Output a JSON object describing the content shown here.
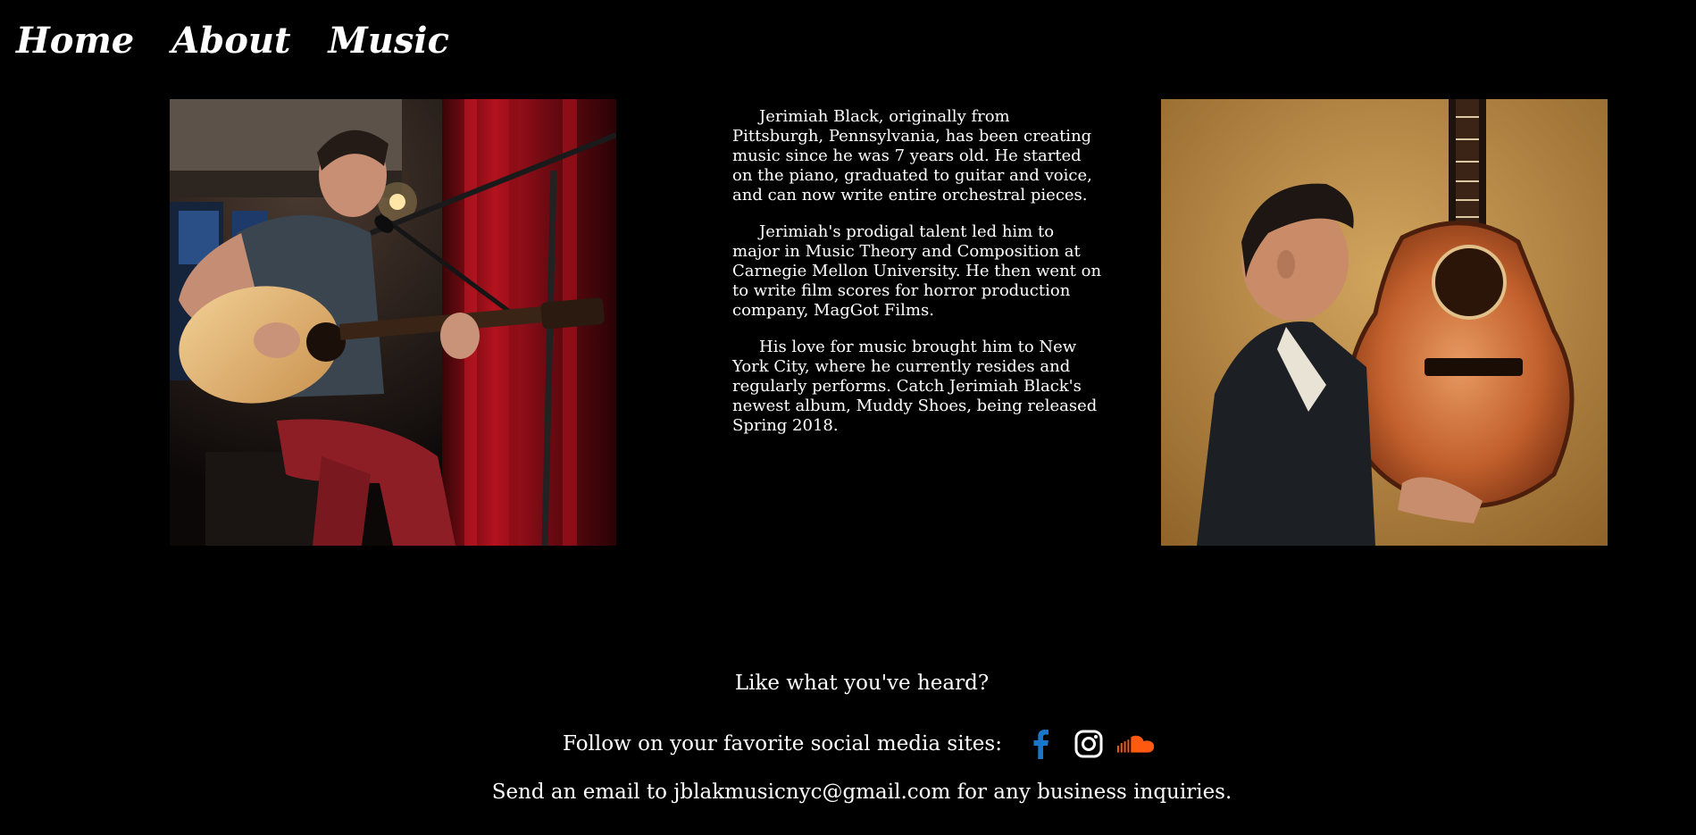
{
  "nav": {
    "items": [
      {
        "label": "Home"
      },
      {
        "label": "About"
      },
      {
        "label": "Music"
      }
    ]
  },
  "bio": {
    "paragraphs": [
      "Jerimiah Black, originally from Pittsburgh, Pennsylvania, has been creating music since he was 7 years old. He started on the piano, graduated to guitar and voice, and can now write entire orchestral pieces.",
      "Jerimiah's prodigal talent led him to major in Music Theory and Composition at Carnegie Mellon University. He then went on to write film scores for horror production company, MagGot Films.",
      "His love for music brought him to New York City, where he currently resides and regularly performs. Catch Jerimiah Black's newest album, Muddy Shoes, being released Spring 2018."
    ]
  },
  "footer": {
    "cta": "Like what you've heard?",
    "follow_label": "Follow on your favorite social media sites:",
    "social": [
      {
        "icon": "facebook-icon",
        "color": "#1877c9"
      },
      {
        "icon": "instagram-icon",
        "color": "#ffffff"
      },
      {
        "icon": "soundcloud-icon",
        "color": "#ff5a10"
      }
    ],
    "email_text": "Send an email to jblakmusicnyc@gmail.com for any business inquiries."
  }
}
